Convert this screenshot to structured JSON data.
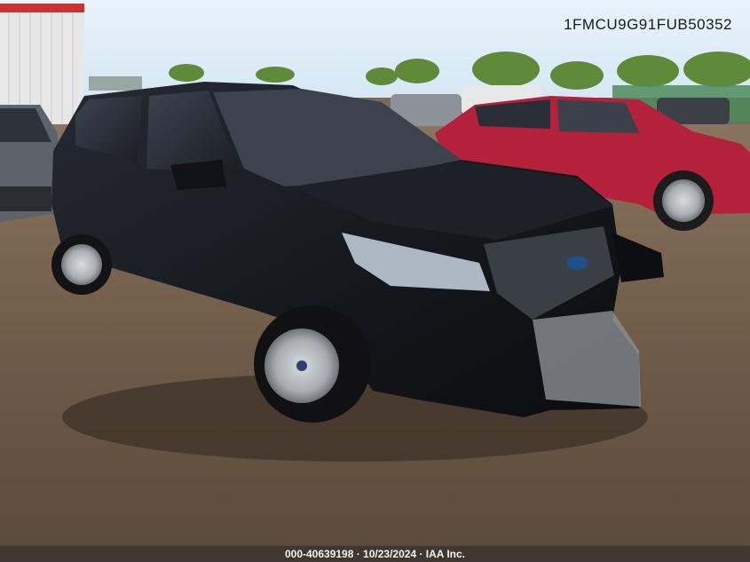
{
  "photo": {
    "vin": "1FMCU9G91FUB50352",
    "caption": "000-40639198 · 10/23/2024 · IAA Inc."
  },
  "colors": {
    "sky": "#cfe4f5",
    "ground": "#6e5a47",
    "vehicle_main": "#15171c",
    "vehicle_red": "#b3213a",
    "trees": "#5f8a3a"
  }
}
